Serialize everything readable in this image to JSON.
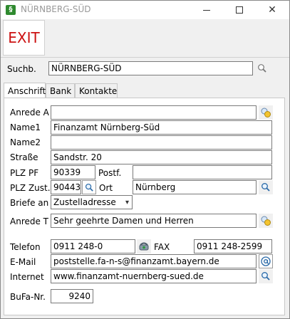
{
  "window": {
    "title": "NÜRNBERG-SÜD",
    "icon": "app-icon",
    "icon_glyph": "§"
  },
  "toolbar": {
    "exit_label": "EXIT"
  },
  "search": {
    "label": "Suchb.",
    "value": "NÜRNBERG-SÜD"
  },
  "tabs": [
    {
      "label": "Anschrift",
      "active": true
    },
    {
      "label": "Bank",
      "active": false
    },
    {
      "label": "Kontakte",
      "active": false
    }
  ],
  "form": {
    "anrede_a": {
      "label": "Anrede A",
      "value": ""
    },
    "name1": {
      "label": "Name1",
      "value": "Finanzamt Nürnberg-Süd"
    },
    "name2": {
      "label": "Name2",
      "value": ""
    },
    "strasse": {
      "label": "Straße",
      "value": "Sandstr. 20"
    },
    "plz_pf": {
      "label": "PLZ PF",
      "value": "90339"
    },
    "postf": {
      "label": "Postf.",
      "value": ""
    },
    "plz_zust": {
      "label": "PLZ Zust.",
      "value": "90443"
    },
    "ort": {
      "label": "Ort",
      "value": "Nürnberg"
    },
    "briefe_an": {
      "label": "Briefe an",
      "value": "Zustelladresse",
      "chevron": "▾"
    },
    "anrede_t": {
      "label": "Anrede T",
      "value": "Sehr geehrte Damen und Herren"
    },
    "telefon": {
      "label": "Telefon",
      "value": "0911 248-0"
    },
    "fax": {
      "label": "FAX",
      "value": "0911 248-2599"
    },
    "email": {
      "label": "E-Mail",
      "value": "poststelle.fa-n-s@finanzamt.bayern.de"
    },
    "internet": {
      "label": "Internet",
      "value": "www.finanzamt-nuernberg-sued.de"
    },
    "bufa": {
      "label": "BuFa-Nr.",
      "value": "9240"
    }
  },
  "window_controls": {
    "minimize": "minimize-icon",
    "maximize": "maximize-icon",
    "close": "✕"
  }
}
